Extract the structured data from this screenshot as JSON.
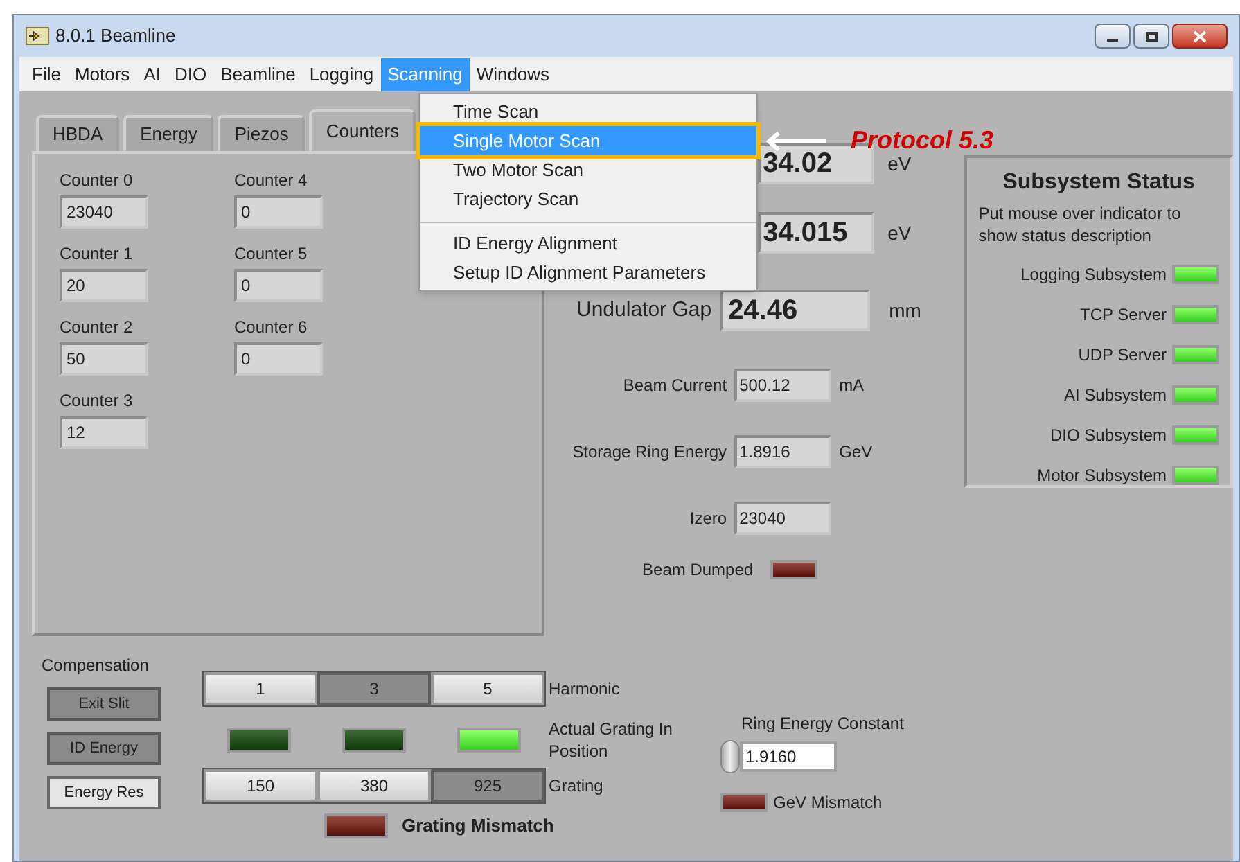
{
  "window": {
    "title": "8.0.1 Beamline"
  },
  "menu": [
    {
      "label": "File",
      "selected": false
    },
    {
      "label": "Motors",
      "selected": false
    },
    {
      "label": "AI",
      "selected": false
    },
    {
      "label": "DIO",
      "selected": false
    },
    {
      "label": "Beamline",
      "selected": false
    },
    {
      "label": "Logging",
      "selected": false
    },
    {
      "label": "Scanning",
      "selected": true
    },
    {
      "label": "Windows",
      "selected": false
    }
  ],
  "dropdown": {
    "groups": [
      [
        {
          "label": "Time Scan",
          "selected": false
        },
        {
          "label": "Single Motor Scan",
          "selected": true
        },
        {
          "label": "Two Motor Scan",
          "selected": false
        },
        {
          "label": "Trajectory Scan",
          "selected": false
        }
      ],
      [
        {
          "label": "ID Energy Alignment",
          "selected": false
        },
        {
          "label": "Setup ID Alignment Parameters",
          "selected": false
        }
      ]
    ]
  },
  "annotation": {
    "text": "Protocol 5.3"
  },
  "tabs": [
    {
      "label": "HBDA",
      "selected": false
    },
    {
      "label": "Energy",
      "selected": false
    },
    {
      "label": "Piezos",
      "selected": false
    },
    {
      "label": "Counters",
      "selected": true
    }
  ],
  "counters": [
    [
      {
        "label": "Counter 0",
        "value": "23040"
      },
      {
        "label": "Counter 1",
        "value": "20"
      },
      {
        "label": "Counter 2",
        "value": "50"
      },
      {
        "label": "Counter 3",
        "value": "12"
      }
    ],
    [
      {
        "label": "Counter 4",
        "value": "0"
      },
      {
        "label": "Counter 5",
        "value": "0"
      },
      {
        "label": "Counter 6",
        "value": "0"
      }
    ]
  ],
  "energy_readouts": [
    {
      "value": "34.02",
      "unit": "eV"
    },
    {
      "value": "34.015",
      "unit": "eV"
    }
  ],
  "readouts": [
    {
      "kind": "large",
      "label": "Undulator Gap",
      "value": "24.46",
      "unit": "mm"
    },
    {
      "kind": "small",
      "label": "Beam Current",
      "value": "500.12",
      "unit": "mA"
    },
    {
      "kind": "small",
      "label": "Storage Ring Energy",
      "value": "1.8916",
      "unit": "GeV"
    },
    {
      "kind": "small",
      "label": "Izero",
      "value": "23040"
    }
  ],
  "beam_dumped": {
    "label": "Beam Dumped",
    "on": false
  },
  "subsystem_status": {
    "title": "Subsystem Status",
    "description": "Put mouse over indicator to show status description",
    "items": [
      {
        "label": "Logging Subsystem",
        "on": true
      },
      {
        "label": "TCP Server",
        "on": true
      },
      {
        "label": "UDP Server",
        "on": true
      },
      {
        "label": "AI Subsystem",
        "on": true
      },
      {
        "label": "DIO Subsystem",
        "on": true
      },
      {
        "label": "Motor Subsystem",
        "on": true
      }
    ]
  },
  "compensation": {
    "title": "Compensation",
    "buttons": [
      {
        "label": "Exit Slit",
        "pressed": true
      },
      {
        "label": "ID Energy",
        "pressed": true
      },
      {
        "label": "Energy Res",
        "pressed": false
      }
    ]
  },
  "harmonic": {
    "label": "Harmonic",
    "options": [
      {
        "label": "1",
        "selected": false
      },
      {
        "label": "3",
        "selected": true
      },
      {
        "label": "5",
        "selected": false
      }
    ]
  },
  "grating_in_position": {
    "label": "Actual Grating In Position",
    "leds": [
      {
        "on": false
      },
      {
        "on": false
      },
      {
        "on": true
      }
    ]
  },
  "grating": {
    "label": "Grating",
    "options": [
      {
        "label": "150",
        "selected": false
      },
      {
        "label": "380",
        "selected": false
      },
      {
        "label": "925",
        "selected": true
      }
    ]
  },
  "grating_mismatch": {
    "label": "Grating Mismatch",
    "on": false
  },
  "ring_energy_constant": {
    "label": "Ring Energy Constant",
    "value": "1.9160"
  },
  "gev_mismatch": {
    "label": "GeV Mismatch",
    "on": false
  }
}
